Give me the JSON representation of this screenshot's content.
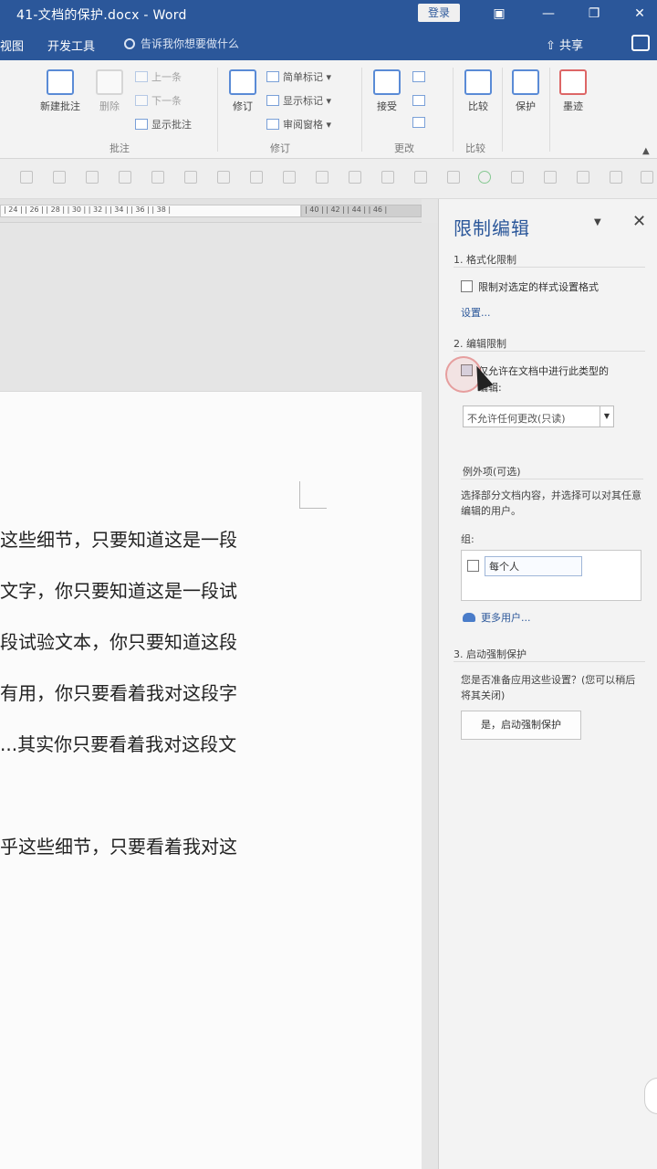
{
  "title_bar": {
    "title": "41-文档的保护.docx - Word",
    "login_label": "登录",
    "icons": [
      "ribbon-display-icon",
      "minimize-icon",
      "restore-icon",
      "close-icon"
    ]
  },
  "ribbon_tabs": {
    "tab_view": "视图",
    "tab_developer": "开发工具",
    "search_text": "告诉我你想要做什么",
    "share_label": "共享"
  },
  "ribbon": {
    "new_comment": "新建批注",
    "delete": "删除",
    "previous": "上一条",
    "next": "下一条",
    "show_comments": "显示批注",
    "group_comments": "批注",
    "track_changes": "修订",
    "simple_markup": "简单标记",
    "show_markup": "显示标记",
    "review_pane": "审阅窗格",
    "group_tracking": "修订",
    "accept": "接受",
    "group_changes": "更改",
    "compare": "比较",
    "group_compare": "比较",
    "protect": "保护",
    "ink": "墨迹"
  },
  "ruler": {
    "marks": "| 24 |  | 26 |  | 28 |  | 30 |  | 32 |  | 34 |  | 36 |  | 38 |",
    "marks_gray": "| 40 |  | 42 |  | 44 |  | 46 |"
  },
  "document": {
    "lines": [
      "这些细节，只要知道这是一段",
      "文字，你只要知道这是一段试",
      "段试验文本，你只要知道这段",
      "有用，你只要看着我对这段字",
      "...其实你只要看着我对这段文",
      "乎这些细节，只要看着我对这"
    ]
  },
  "pane": {
    "title": "限制编辑",
    "section1_title": "1. 格式化限制",
    "section1_checkbox": "限制对选定的样式设置格式",
    "section1_link": "设置...",
    "section2_title": "2. 编辑限制",
    "section2_checkbox_line1": "仅允许在文档中进行此类型的",
    "section2_checkbox_line2": "编辑:",
    "edit_type_select": "不允许任何更改(只读)",
    "exceptions_title": "例外项(可选)",
    "exceptions_desc": "选择部分文档内容，并选择可以对其任意编辑的用户。",
    "groups_label": "组:",
    "group_everyone": "每个人",
    "more_users": "更多用户...",
    "section3_title": "3. 启动强制保护",
    "section3_desc": "您是否准备应用这些设置？(您可以稍后将其关闭)",
    "start_button": "是，启动强制保护"
  }
}
